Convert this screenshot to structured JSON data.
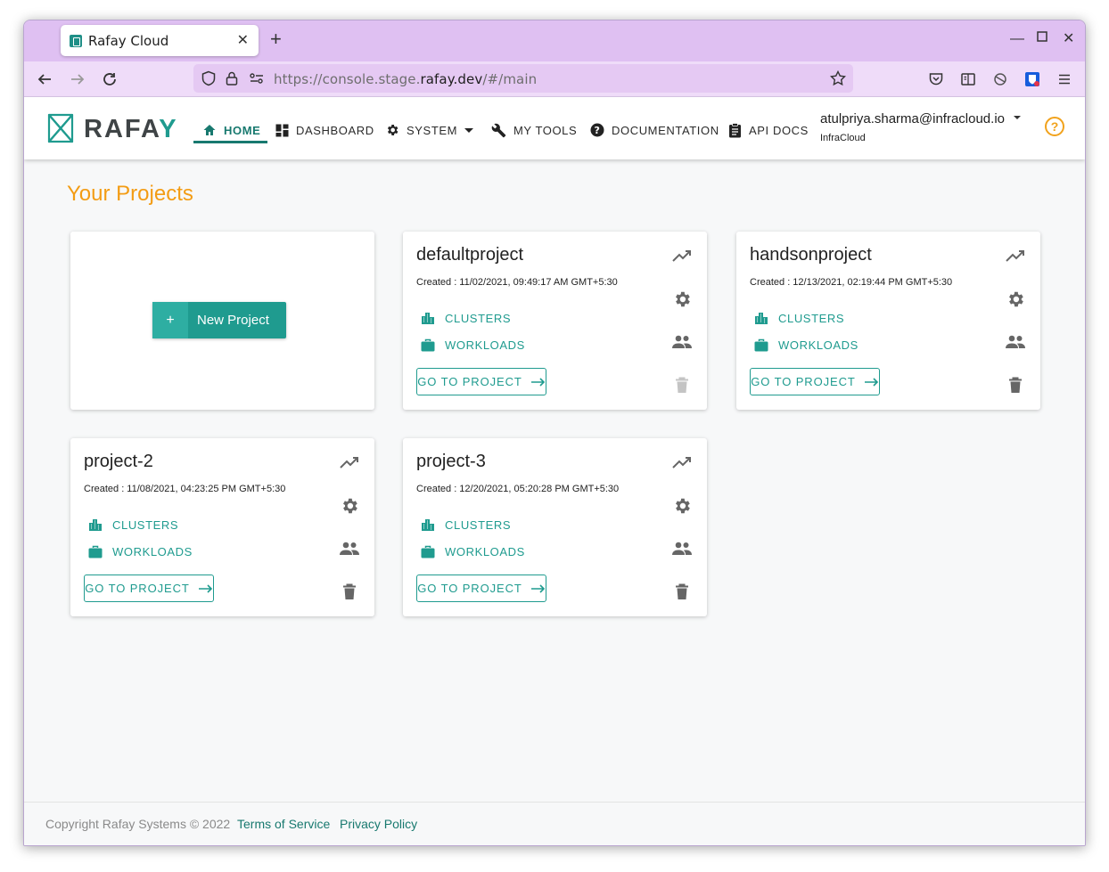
{
  "browser": {
    "tab_title": "Rafay Cloud",
    "url_prefix": "https://console.stage.",
    "url_domain": "rafay.dev",
    "url_suffix": "/#/main"
  },
  "app": {
    "logo_text": "RAFA",
    "logo_text_accent": "Y",
    "nav": [
      {
        "label": "HOME",
        "icon": "home-icon"
      },
      {
        "label": "DASHBOARD",
        "icon": "dashboard-icon"
      },
      {
        "label": "SYSTEM",
        "icon": "gear-icon"
      },
      {
        "label": "MY TOOLS",
        "icon": "wrench-icon"
      },
      {
        "label": "DOCUMENTATION",
        "icon": "help-circle-icon"
      },
      {
        "label": "API DOCS",
        "icon": "clipboard-icon"
      }
    ],
    "user_email": "atulpriya.sharma@infracloud.io",
    "user_org": "InfraCloud",
    "help_icon_glyph": "?"
  },
  "page": {
    "title": "Your Projects",
    "new_project_plus": "+",
    "new_project_label": "New Project"
  },
  "labels": {
    "clusters": "CLUSTERS",
    "workloads": "WORKLOADS",
    "goto": "GO TO PROJECT"
  },
  "projects": [
    {
      "name": "defaultproject",
      "created": "Created :  11/02/2021, 09:49:17 AM GMT+5:30",
      "delete_enabled": false
    },
    {
      "name": "handsonproject",
      "created": "Created :  12/13/2021, 02:19:44 PM GMT+5:30",
      "delete_enabled": true
    },
    {
      "name": "project-2",
      "created": "Created :  11/08/2021, 04:23:25 PM GMT+5:30",
      "delete_enabled": true
    },
    {
      "name": "project-3",
      "created": "Created :  12/20/2021, 05:20:28 PM GMT+5:30",
      "delete_enabled": true
    }
  ],
  "footer": {
    "copyright": "Copyright Rafay Systems © 2022",
    "terms": "Terms of Service",
    "privacy": "Privacy Policy"
  },
  "colors": {
    "accent": "#1f9b8f",
    "title_orange": "#f39c14",
    "browser_chrome": "#dfc0f2"
  }
}
